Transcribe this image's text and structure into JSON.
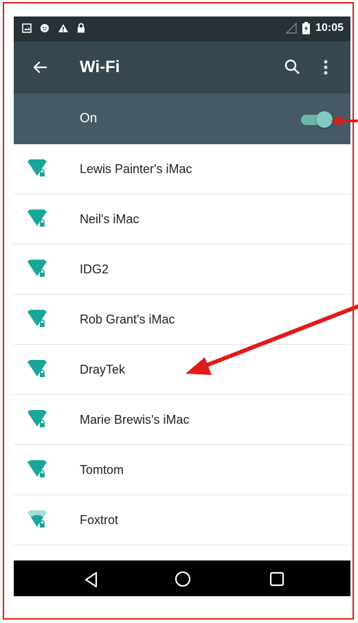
{
  "status_bar": {
    "time": "10:05",
    "icons": [
      "image-notification-icon",
      "smiley-notification-icon",
      "warning-icon",
      "lock-icon",
      "signal-icon",
      "battery-icon"
    ]
  },
  "app_bar": {
    "title": "Wi-Fi",
    "icons": [
      "back-arrow-icon",
      "search-icon",
      "more-vert-icon"
    ]
  },
  "wifi_toggle": {
    "label": "On",
    "state": "on",
    "accent_color": "#80cbc4"
  },
  "networks": [
    {
      "name": "Lewis Painter's iMac",
      "signal": "full",
      "secured": true
    },
    {
      "name": "Neil's iMac",
      "signal": "full",
      "secured": true
    },
    {
      "name": "IDG2",
      "signal": "full",
      "secured": true
    },
    {
      "name": "Rob Grant's iMac",
      "signal": "full",
      "secured": true
    },
    {
      "name": "DrayTek",
      "signal": "full",
      "secured": true
    },
    {
      "name": "Marie Brewis's iMac",
      "signal": "full",
      "secured": true
    },
    {
      "name": "Tomtom",
      "signal": "full",
      "secured": true
    },
    {
      "name": "Foxtrot",
      "signal": "partial",
      "secured": true
    },
    {
      "name": "",
      "signal": "weak",
      "secured": true
    }
  ],
  "nav_bar": {
    "icons": [
      "nav-back-icon",
      "nav-home-icon",
      "nav-recents-icon"
    ]
  },
  "colors": {
    "status_bar": "#263238",
    "app_bar": "#37474f",
    "toggle_bar": "#455a64",
    "wifi_icon": "#1aa59a",
    "annotation_arrow": "#e11b1b"
  }
}
